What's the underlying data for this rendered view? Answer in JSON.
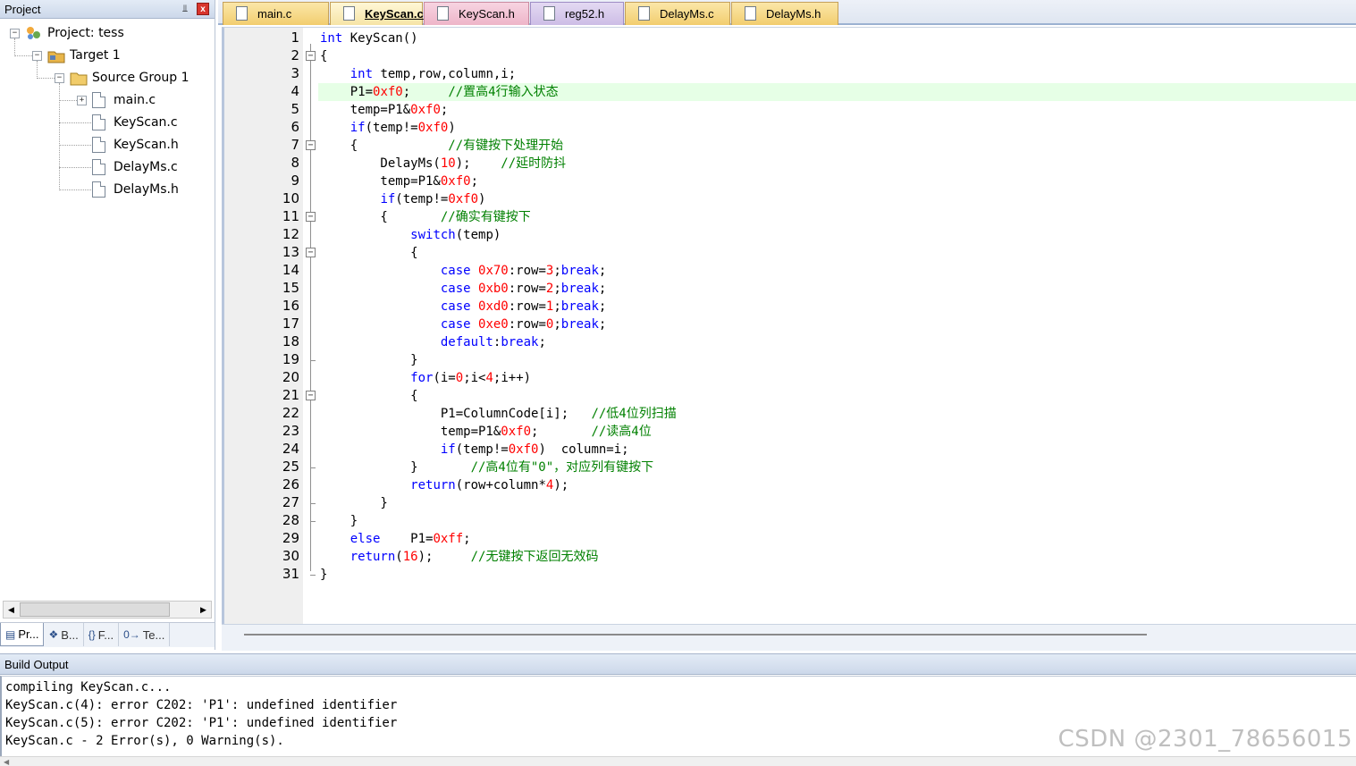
{
  "project_panel": {
    "title": "Project",
    "pin_glyph": "⫫",
    "close_glyph": "x",
    "tree": {
      "root": "Project: tess",
      "target": "Target 1",
      "group": "Source Group 1",
      "files": [
        "main.c",
        "KeyScan.c",
        "KeyScan.h",
        "DelayMs.c",
        "DelayMs.h"
      ]
    },
    "bottom_tabs": [
      {
        "icon": "▤",
        "label": "Pr..."
      },
      {
        "icon": "❖",
        "label": "B..."
      },
      {
        "icon": "{}",
        "label": "F..."
      },
      {
        "icon": "0→",
        "label": "Te..."
      }
    ]
  },
  "editor": {
    "tabs": [
      {
        "label": "main.c",
        "kind": "c"
      },
      {
        "label": "KeyScan.c",
        "kind": "c",
        "active": true
      },
      {
        "label": "KeyScan.h",
        "kind": "h"
      },
      {
        "label": "reg52.h",
        "kind": "r"
      },
      {
        "label": "DelayMs.c",
        "kind": "c"
      },
      {
        "label": "DelayMs.h",
        "kind": "c"
      }
    ],
    "current_line": 4,
    "lines": [
      "int KeyScan()",
      "{",
      "    int temp,row,column,i;",
      "    P1=0xf0;     //置高4行输入状态",
      "    temp=P1&0xf0;",
      "    if(temp!=0xf0)",
      "    {            //有键按下处理开始",
      "        DelayMs(10);    //延时防抖",
      "        temp=P1&0xf0;",
      "        if(temp!=0xf0)",
      "        {       //确实有键按下",
      "            switch(temp)",
      "            {",
      "                case 0x70:row=3;break;",
      "                case 0xb0:row=2;break;",
      "                case 0xd0:row=1;break;",
      "                case 0xe0:row=0;break;",
      "                default:break;",
      "            }",
      "            for(i=0;i<4;i++)",
      "            {",
      "                P1=ColumnCode[i];   //低4位列扫描",
      "                temp=P1&0xf0;       //读高4位",
      "                if(temp!=0xf0)  column=i;",
      "            }       //高4位有\"0\"，对应列有键按下",
      "            return(row+column*4);",
      "        }",
      "    }",
      "    else    P1=0xff;",
      "    return(16);     //无键按下返回无效码",
      "}"
    ],
    "folds": [
      {
        "line": 2,
        "end": 31
      },
      {
        "line": 7,
        "end": 28
      },
      {
        "line": 11,
        "end": 27
      },
      {
        "line": 13,
        "end": 19
      },
      {
        "line": 21,
        "end": 25
      }
    ],
    "colors": {
      "keyword": "#0000ff",
      "number": "#ff0000",
      "comment": "#008000",
      "current_line_bg": "#e6ffe6"
    }
  },
  "build_output": {
    "title": "Build Output",
    "lines": [
      "compiling KeyScan.c...",
      "KeyScan.c(4): error C202: 'P1': undefined identifier",
      "KeyScan.c(5): error C202: 'P1': undefined identifier",
      "KeyScan.c - 2 Error(s), 0 Warning(s)."
    ]
  },
  "watermark": "CSDN @2301_78656015"
}
